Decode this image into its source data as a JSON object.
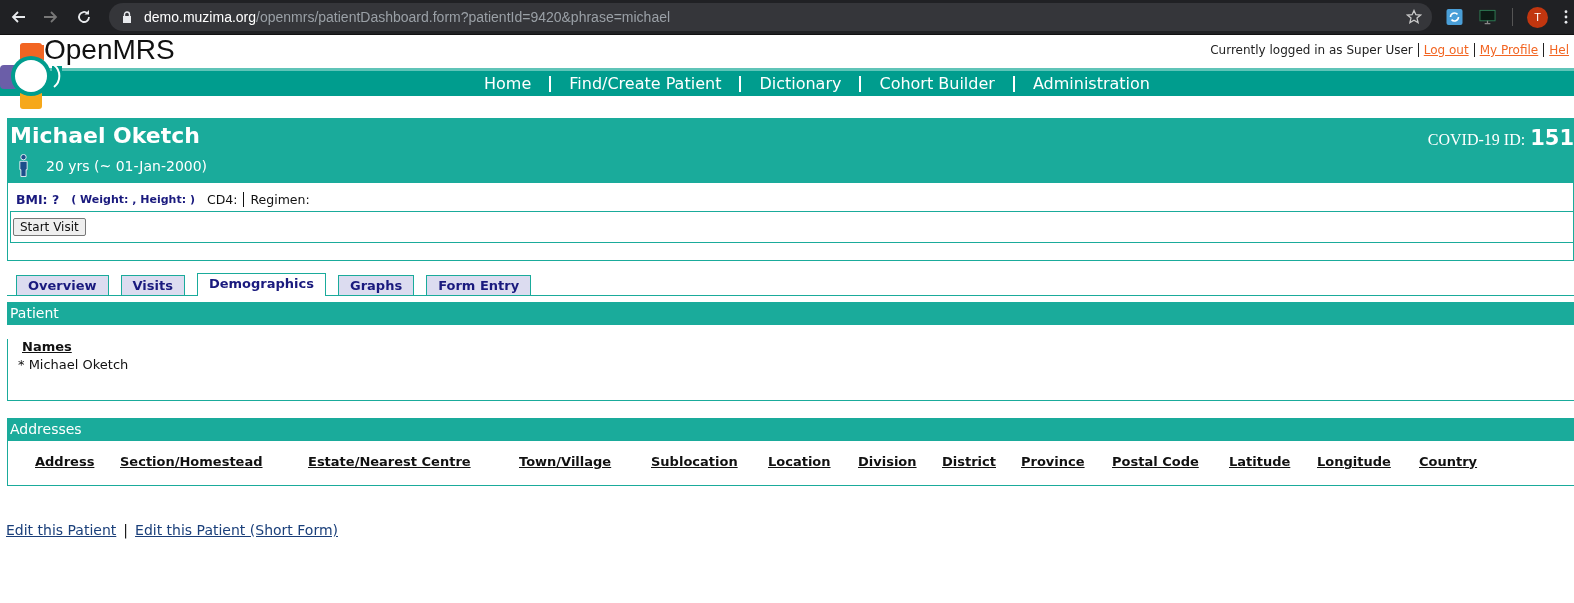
{
  "browser": {
    "nav_buttons": [
      {
        "kind": "back",
        "disabled": false
      },
      {
        "kind": "forward",
        "disabled": true
      },
      {
        "kind": "reload",
        "disabled": false
      }
    ],
    "url_host": "demo.muzima.org",
    "url_path": "/openmrs/patientDashboard.form?patientId=9420&phrase=michael",
    "avatar": "T"
  },
  "header": {
    "logo_text": "OpenMRS",
    "user_text": "Currently logged in as Super User",
    "user_links": [
      "Log out",
      "My Profile",
      "Hel"
    ],
    "nav": [
      "Home",
      "Find/Create Patient",
      "Dictionary",
      "Cohort Builder",
      "Administration"
    ]
  },
  "patient": {
    "name": "Michael Oketch",
    "age": "20 yrs (~ 01-Jan-2000)",
    "id_label": "COVID-19 ID:",
    "id_value": "151"
  },
  "summary": {
    "bmi": "BMI: ?",
    "weight_height": "( Weight: , Height: )",
    "cd4": "CD4:",
    "regimen": "Regimen:",
    "button": "Start Visit"
  },
  "tabs": [
    {
      "label": "Overview",
      "selected": false
    },
    {
      "label": "Visits",
      "selected": false
    },
    {
      "label": "Demographics",
      "selected": true
    },
    {
      "label": "Graphs",
      "selected": false
    },
    {
      "label": "Form Entry",
      "selected": false
    }
  ],
  "patient_section": {
    "title": "Patient",
    "names_heading": "Names",
    "names": [
      "* Michael Oketch"
    ]
  },
  "addresses_section": {
    "title": "Addresses",
    "columns": [
      "Address",
      "Section/Homestead",
      "Estate/Nearest Centre",
      "Town/Village",
      "Sublocation",
      "Location",
      "Division",
      "District",
      "Province",
      "Postal Code",
      "Latitude",
      "Longitude",
      "Country"
    ]
  },
  "footer_links": [
    "Edit this Patient",
    "Edit this Patient (Short Form)"
  ],
  "footer_separator": "|"
}
